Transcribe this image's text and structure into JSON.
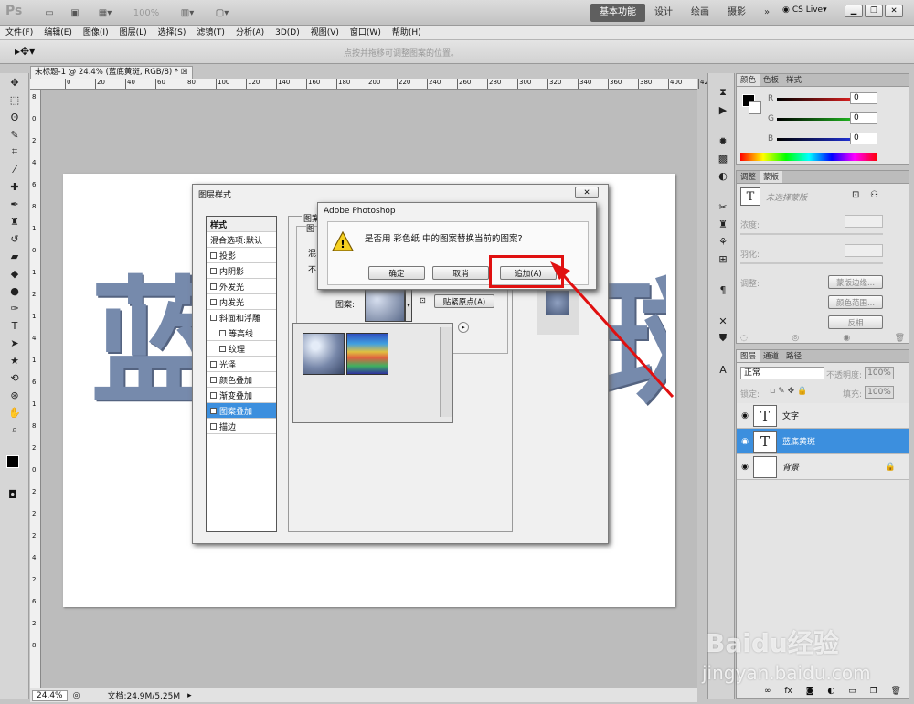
{
  "app": {
    "logo": "Ps",
    "zoom": "100%",
    "workspace_tabs": [
      "基本功能",
      "设计",
      "绘画",
      "摄影"
    ],
    "more": "»",
    "cslive": "CS Live"
  },
  "menu": [
    "文件(F)",
    "编辑(E)",
    "图像(I)",
    "图层(L)",
    "选择(S)",
    "滤镜(T)",
    "分析(A)",
    "3D(D)",
    "视图(V)",
    "窗口(W)",
    "帮助(H)"
  ],
  "options": {
    "hint": "点按并拖移可调整图案的位置。"
  },
  "document": {
    "tab_title": "未标题-1 @ 24.4% (蓝底黄斑, RGB/8) *",
    "canvas_text": "蓝",
    "canvas_text_right": "斑",
    "ruler_h": [
      "0",
      "20",
      "40",
      "60",
      "80",
      "100",
      "120",
      "140",
      "160",
      "180",
      "200",
      "220",
      "240",
      "260",
      "280",
      "300",
      "320",
      "340",
      "360",
      "380",
      "400",
      "420"
    ],
    "ruler_v": [
      "8",
      "0",
      "2",
      "4",
      "6",
      "8",
      "1",
      "0",
      "1",
      "2",
      "1",
      "4",
      "1",
      "6",
      "1",
      "8",
      "2",
      "0",
      "2",
      "2",
      "2",
      "4",
      "2",
      "6",
      "2",
      "8"
    ]
  },
  "status": {
    "zoom": "24.4%",
    "doc_size": "文档:24.9M/5.25M"
  },
  "color_panel": {
    "tabs": [
      "颜色",
      "色板",
      "样式"
    ],
    "labels": [
      "R",
      "G",
      "B"
    ],
    "values": [
      "0",
      "0",
      "0"
    ],
    "colors": {
      "r": "#d42020",
      "g": "#20b020",
      "b": "#2030d0"
    }
  },
  "adjust_panel": {
    "tabs": [
      "调整",
      "蒙版"
    ],
    "mask_label": "未选择蒙版",
    "density_label": "浓度:",
    "feather_label": "羽化:",
    "refine_label": "调整:",
    "buttons": [
      "蒙版边缘...",
      "颜色范围...",
      "反相"
    ]
  },
  "layers_panel": {
    "tabs": [
      "图层",
      "通道",
      "路径"
    ],
    "blend": "正常",
    "opacity_label": "不透明度:",
    "opacity": "100%",
    "lock_label": "锁定:",
    "fill_label": "填充:",
    "fill": "100%",
    "layers": [
      {
        "name": "文字",
        "type": "text",
        "selected": false
      },
      {
        "name": "蓝底黄斑",
        "type": "text",
        "selected": true
      },
      {
        "name": "背景",
        "type": "image",
        "selected": false
      }
    ]
  },
  "layer_style": {
    "title": "图层样式",
    "header": "样式",
    "items": [
      {
        "label": "混合选项:默认",
        "check": false,
        "has_check": false
      },
      {
        "label": "投影",
        "check": false,
        "has_check": true
      },
      {
        "label": "内阴影",
        "check": false,
        "has_check": true
      },
      {
        "label": "外发光",
        "check": false,
        "has_check": true
      },
      {
        "label": "内发光",
        "check": false,
        "has_check": true
      },
      {
        "label": "斜面和浮雕",
        "check": false,
        "has_check": true
      },
      {
        "label": "等高线",
        "check": false,
        "has_check": true,
        "indent": true
      },
      {
        "label": "纹理",
        "check": false,
        "has_check": true,
        "indent": true
      },
      {
        "label": "光泽",
        "check": false,
        "has_check": true
      },
      {
        "label": "颜色叠加",
        "check": false,
        "has_check": true
      },
      {
        "label": "渐变叠加",
        "check": false,
        "has_check": true
      },
      {
        "label": "图案叠加",
        "check": true,
        "has_check": true,
        "selected": true
      },
      {
        "label": "描边",
        "check": false,
        "has_check": true
      }
    ],
    "group_label": "图案",
    "sub_label": "图",
    "mix_label": "混",
    "opacity_abbr": "不",
    "pattern_label": "图案:",
    "snap_button": "贴紧原点(A)"
  },
  "alert": {
    "title": "Adobe Photoshop",
    "message": "是否用 彩色纸 中的图案替换当前的图案?",
    "buttons": [
      "确定",
      "取消",
      "追加(A)"
    ]
  },
  "watermark": {
    "text": "Baidu经验",
    "url": "jingyan.baidu.com"
  }
}
